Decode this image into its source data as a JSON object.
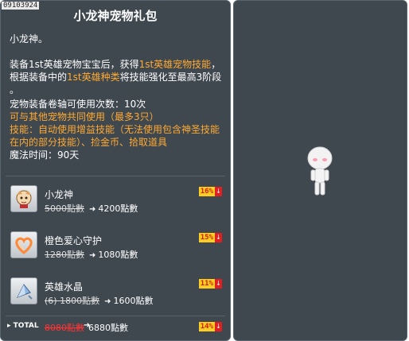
{
  "item_id": "09103924",
  "title": "小龙神宠物礼包",
  "desc": {
    "line1": "小龙神。",
    "p2_a": "装备1st英雄宠物宝宝后，获得",
    "p2_b": "1st英雄宠物技能",
    "p2_c": "，",
    "p2_d": "根据装备中的",
    "p2_e": "1st英雄种类",
    "p2_f": "将技能强化至最高3阶段",
    "p2_g": "。",
    "scroll_uses": "宠物装备卷轴可使用次数：10次",
    "shared_use": "可与其他宠物共同使用（最多3只）",
    "skill": "技能：自动使用增益技能（无法使用包含神圣技能在内的部分技能）、捡金币、拾取道具",
    "magic_time": "魔法时间：90天"
  },
  "items": [
    {
      "name": "小龙神",
      "old_price": "5000點數",
      "new_price": "4200點數",
      "discount": "16%",
      "icon": "dragon-pet-icon"
    },
    {
      "name": "橙色爱心守护",
      "old_price": "1280點數",
      "new_price": "1080點數",
      "discount": "15%",
      "icon": "heart-guard-icon"
    },
    {
      "name": "英雄水晶",
      "old_price": "(6) 1800點數",
      "new_price": "1600點數",
      "discount": "11%",
      "icon": "crystal-icon"
    }
  ],
  "total": {
    "label": "TOTAL",
    "old_price": "8080點數",
    "new_price": "6880點數",
    "discount": "14%"
  },
  "colors": {
    "panel_bg": "#3f474f",
    "highlight": "#ffaa33",
    "discount_bg": "#ffcc22",
    "discount_arrow": "#e02020"
  }
}
